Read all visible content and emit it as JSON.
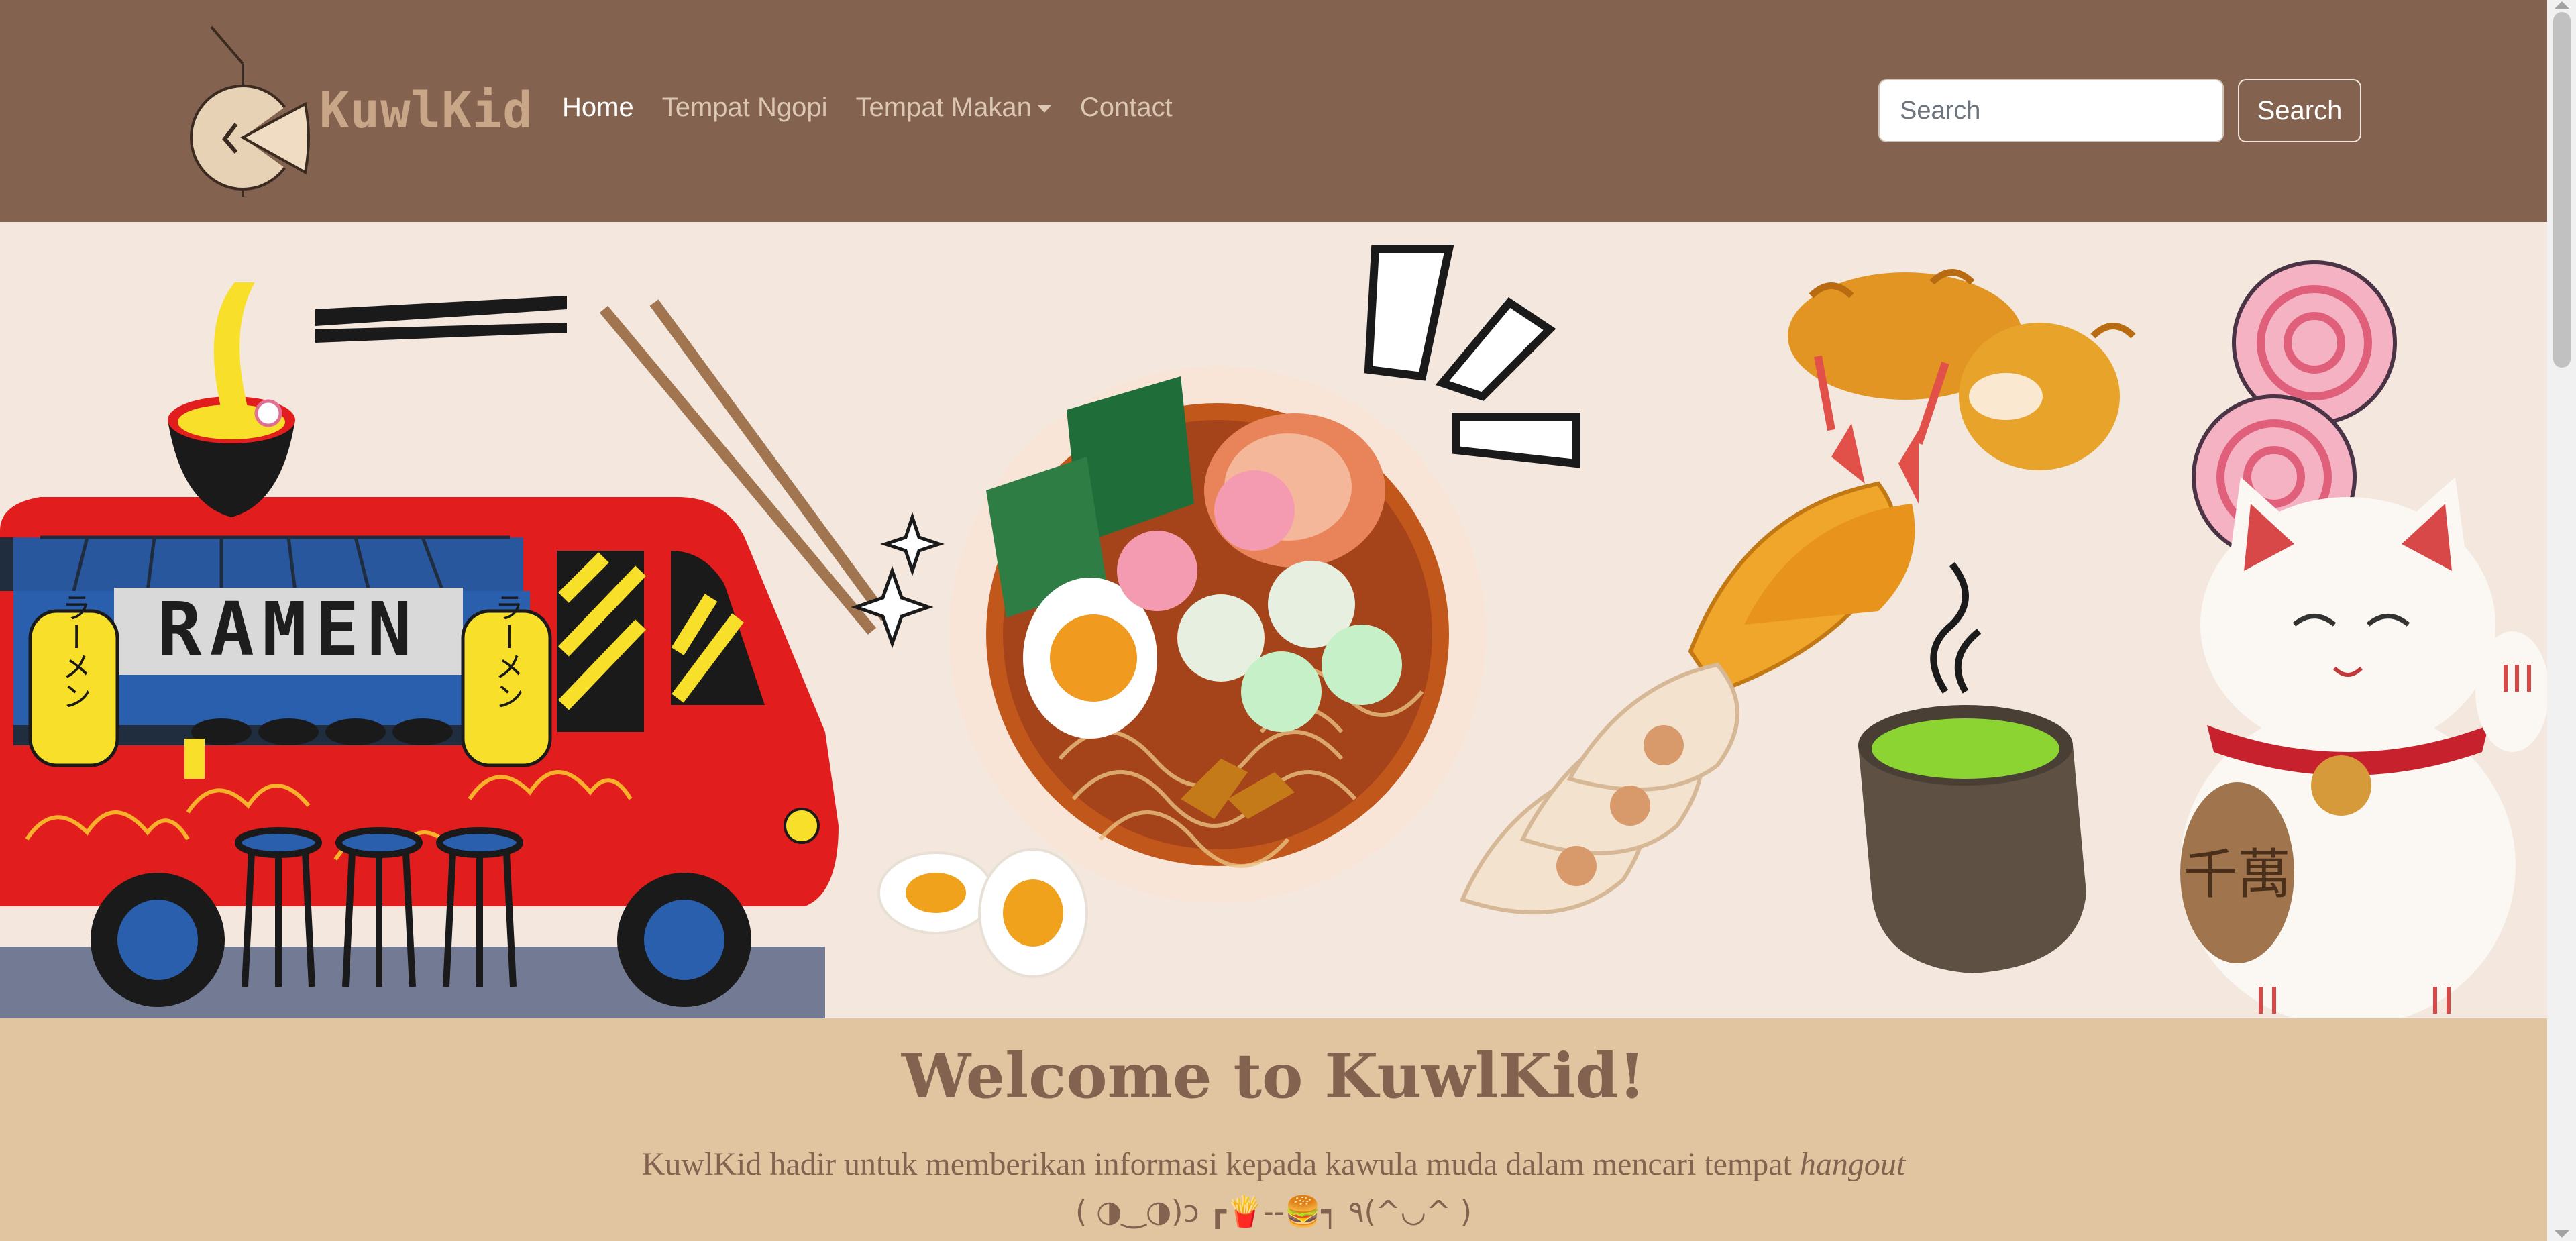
{
  "brand": {
    "name": "KuwlKid",
    "logo_icon": "kuwlkid-logo-icon"
  },
  "nav": {
    "items": [
      {
        "label": "Home",
        "active": true
      },
      {
        "label": "Tempat Ngopi",
        "active": false
      },
      {
        "label": "Tempat Makan",
        "active": false,
        "dropdown": true
      },
      {
        "label": "Contact",
        "active": false
      }
    ]
  },
  "search": {
    "placeholder": "Search",
    "value": "",
    "button_label": "Search"
  },
  "hero": {
    "banner_text": "RAMEN",
    "lantern_text_left": "ラーメン",
    "lantern_text_right": "ラーメン",
    "coin_text": "千萬"
  },
  "welcome": {
    "title": "Welcome to KuwlKid!",
    "subtitle_main": "KuwlKid hadir untuk memberikan informasi kepada kawula muda dalam mencari tempat ",
    "subtitle_em": "hangout",
    "kaomoji": "( ◑‿◑)ɔ ┏🍟--🍔┑ ٩(^◡^ )"
  },
  "colors": {
    "navbar_bg": "#83634f",
    "hero_bg": "#f4e8de",
    "welcome_bg": "#e0c5a0",
    "accent_text": "#83634f"
  }
}
